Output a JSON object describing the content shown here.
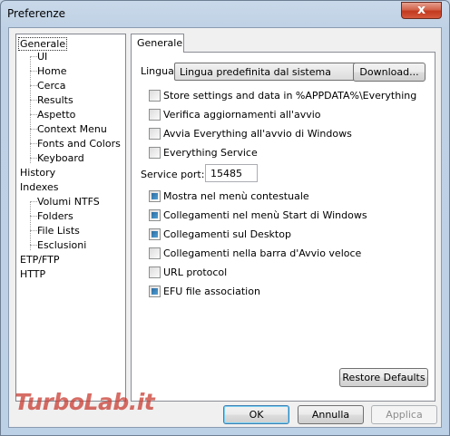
{
  "window": {
    "title": "Preferenze",
    "close_label": "x"
  },
  "tree": {
    "items": [
      {
        "label": "Generale"
      },
      {
        "label": "UI"
      },
      {
        "label": "Home"
      },
      {
        "label": "Cerca"
      },
      {
        "label": "Results"
      },
      {
        "label": "Aspetto"
      },
      {
        "label": "Context Menu"
      },
      {
        "label": "Fonts and Colors"
      },
      {
        "label": "Keyboard"
      },
      {
        "label": "History"
      },
      {
        "label": "Indexes"
      },
      {
        "label": "Volumi NTFS"
      },
      {
        "label": "Folders"
      },
      {
        "label": "File Lists"
      },
      {
        "label": "Esclusioni"
      },
      {
        "label": "ETP/FTP"
      },
      {
        "label": "HTTP"
      }
    ]
  },
  "tab": {
    "label": "Generale"
  },
  "language": {
    "label": "Lingua",
    "value": "Lingua predefinita dal sistema",
    "download_label": "Download..."
  },
  "options": [
    {
      "label": "Store settings and data in %APPDATA%\\Everything",
      "checked": false
    },
    {
      "label": "Verifica aggiornamenti all'avvio",
      "checked": false
    },
    {
      "label": "Avvia Everything all'avvio di Windows",
      "checked": false
    },
    {
      "label": "Everything Service",
      "checked": false
    }
  ],
  "service_port": {
    "label": "Service port:",
    "value": "15485"
  },
  "options2": [
    {
      "label": "Mostra nel menù contestuale",
      "checked": true
    },
    {
      "label": "Collegamenti nel menù Start di Windows",
      "checked": true
    },
    {
      "label": "Collegamenti sul Desktop",
      "checked": true
    },
    {
      "label": "Collegamenti nella barra d'Avvio veloce",
      "checked": false
    },
    {
      "label": "URL protocol",
      "checked": false
    },
    {
      "label": "EFU file association",
      "checked": true
    }
  ],
  "buttons": {
    "restore": "Restore Defaults",
    "ok": "OK",
    "cancel": "Annulla",
    "apply": "Applica"
  },
  "watermark": {
    "text": "TurboLab.it"
  }
}
